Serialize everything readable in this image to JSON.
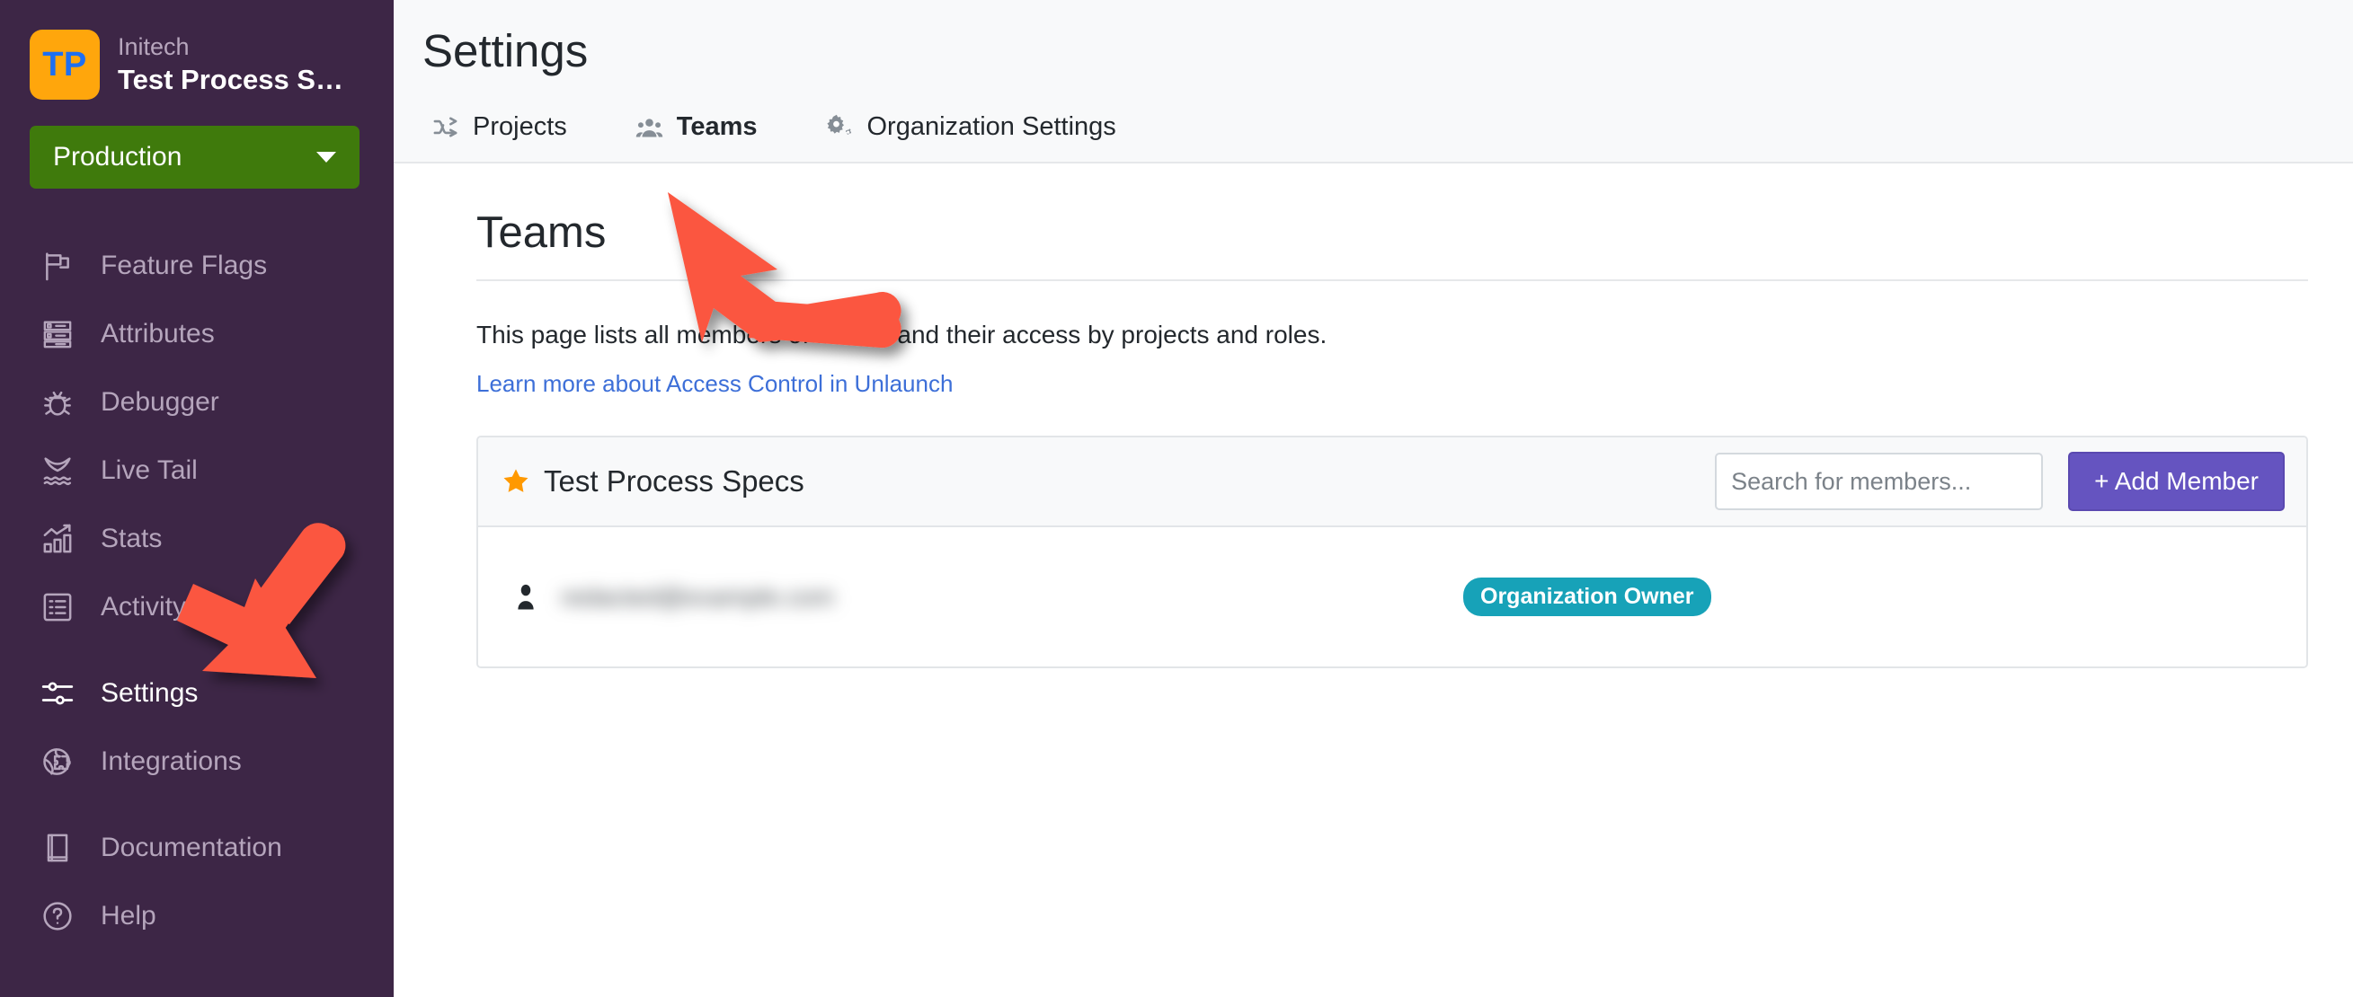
{
  "sidebar": {
    "brand": {
      "logo_initials": "TP",
      "org_name": "Initech",
      "project_name": "Test Process S…"
    },
    "environment": {
      "label": "Production"
    },
    "items": [
      {
        "label": "Feature Flags",
        "icon": "flag-icon",
        "active": false
      },
      {
        "label": "Attributes",
        "icon": "attributes-icon",
        "active": false
      },
      {
        "label": "Debugger",
        "icon": "bug-icon",
        "active": false
      },
      {
        "label": "Live Tail",
        "icon": "whale-tail-icon",
        "active": false
      },
      {
        "label": "Stats",
        "icon": "stats-chart-icon",
        "active": false
      },
      {
        "label": "Activity",
        "icon": "activity-list-icon",
        "active": false
      },
      {
        "label": "Settings",
        "icon": "sliders-icon",
        "active": true
      },
      {
        "label": "Integrations",
        "icon": "puzzle-globe-icon",
        "active": false
      },
      {
        "label": "Documentation",
        "icon": "book-icon",
        "active": false
      },
      {
        "label": "Help",
        "icon": "question-circle-icon",
        "active": false
      }
    ]
  },
  "header": {
    "title": "Settings"
  },
  "tabs": [
    {
      "label": "Projects",
      "icon": "shuffle-icon",
      "active": false
    },
    {
      "label": "Teams",
      "icon": "people-icon",
      "active": true
    },
    {
      "label": "Organization Settings",
      "icon": "gears-icon",
      "active": false
    }
  ],
  "main": {
    "section_title": "Teams",
    "description": "This page lists all members of Initech and their access by projects and roles.",
    "learn_more_link": "Learn more about Access Control in Unlaunch"
  },
  "team_card": {
    "title": "Test Process Specs",
    "star_icon": "star-icon",
    "search": {
      "value": "",
      "placeholder": "Search for members..."
    },
    "add_member_label": "+ Add Member",
    "members": [
      {
        "avatar_icon": "person-icon",
        "email": "redacted@example.com",
        "role": "Organization Owner"
      }
    ]
  },
  "colors": {
    "sidebar_bg": "#3d2646",
    "env_green": "#3f7a0c",
    "logo_orange": "#ffa60c",
    "logo_text_blue": "#1d6ff2",
    "primary_purple": "#6554c0",
    "badge_teal": "#17a2b8",
    "link_blue": "#3d6fd8",
    "star_orange": "#ff9900",
    "annotation_red": "#fb5741",
    "header_bg": "#f8f9fa"
  }
}
